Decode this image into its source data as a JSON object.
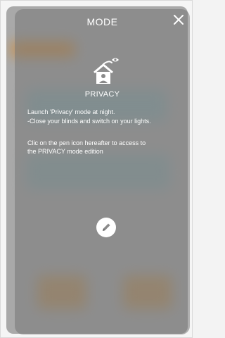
{
  "modal": {
    "title": "MODE",
    "mode_name": "PRIVACY",
    "description_lines": [
      "Launch 'Privacy' mode at night.",
      "-Close your blinds and switch on your lights.",
      "Clic on the pen icon hereafter to access to",
      "the PRIVACY mode edition"
    ],
    "icons": {
      "close": "close-icon",
      "mode": "house-privacy-icon",
      "edit": "pen-icon"
    }
  },
  "colors": {
    "overlay": "#767676",
    "text": "#ffffff"
  }
}
